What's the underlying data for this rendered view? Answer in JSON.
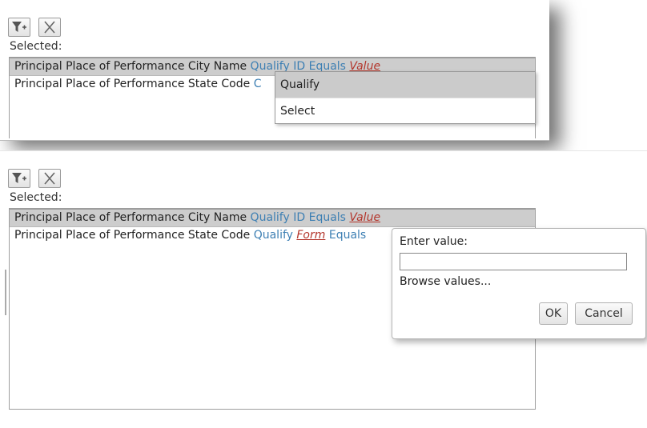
{
  "top": {
    "toolbar": {
      "add_filter_icon": "filter-plus-icon",
      "remove_icon": "close-x-icon"
    },
    "selected_label": "Selected:",
    "rows": [
      {
        "field": "Principal Place of Performance City Name",
        "qualify": "Qualify",
        "id": "ID",
        "op": "Equals",
        "value": "Value"
      },
      {
        "field": "Principal Place of Performance State Code",
        "partial": "C"
      }
    ],
    "menu": {
      "items": [
        "Qualify",
        "Select"
      ]
    }
  },
  "bottom": {
    "toolbar": {
      "add_filter_icon": "filter-plus-icon",
      "remove_icon": "close-x-icon"
    },
    "selected_label": "Selected:",
    "rows": [
      {
        "field": "Principal Place of Performance City Name",
        "qualify": "Qualify",
        "id": "ID",
        "op": "Equals",
        "value": "Value"
      },
      {
        "field": "Principal Place of Performance State Code",
        "qualify": "Qualify",
        "form": "Form",
        "op": "Equals"
      }
    ],
    "dialog": {
      "enter_label": "Enter value:",
      "input_value": "",
      "browse_label": "Browse values...",
      "ok_label": "OK",
      "cancel_label": "Cancel"
    }
  },
  "colors": {
    "keyword": "#3d7fb3",
    "value": "#b3352b",
    "selected_row": "#cdcdcd"
  }
}
